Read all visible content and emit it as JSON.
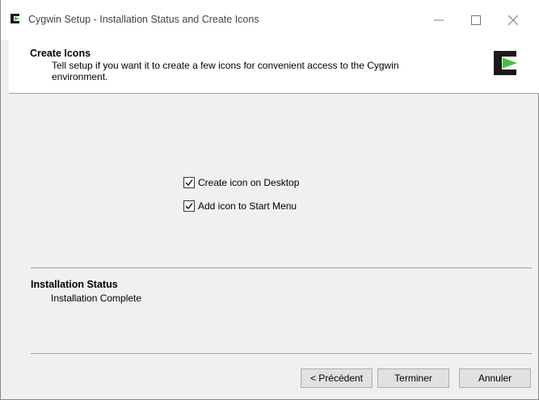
{
  "window": {
    "title": "Cygwin Setup - Installation Status and Create Icons",
    "app_icon": "cygwin-logo-icon",
    "controls": [
      "minimize-icon",
      "maximize-icon",
      "close-icon"
    ]
  },
  "header": {
    "title": "Create Icons",
    "description": "Tell setup if you want it to create a few icons for convenient access to the Cygwin environment.",
    "logo": "cygwin-logo-icon"
  },
  "options": [
    {
      "label": "Create icon on Desktop",
      "checked": true
    },
    {
      "label": "Add icon to Start Menu",
      "checked": true
    }
  ],
  "status": {
    "title": "Installation Status",
    "text": "Installation Complete"
  },
  "buttons": {
    "back": "< Précédent",
    "finish": "Terminer",
    "cancel": "Annuler"
  },
  "colors": {
    "logo_black": "#1a1a1a",
    "logo_green": "#3cc63c"
  }
}
